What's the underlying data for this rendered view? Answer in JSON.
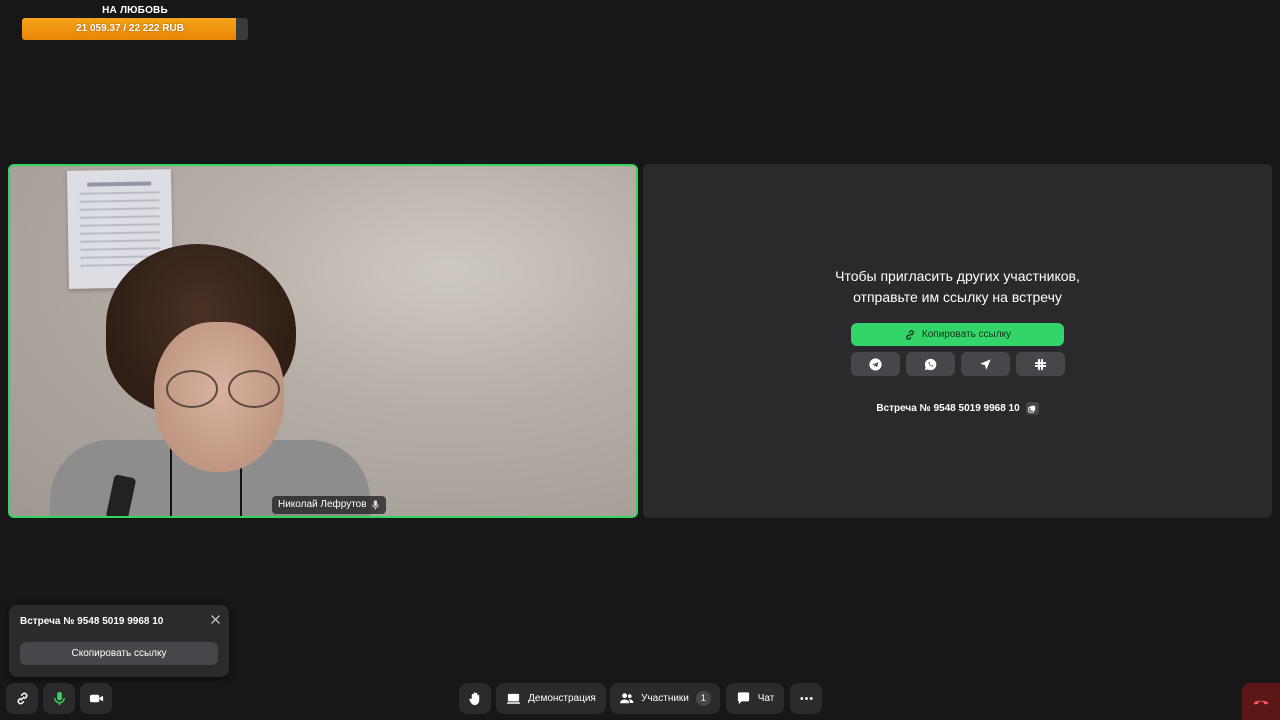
{
  "donation": {
    "title": "НА ЛЮБОВЬ",
    "amount_text": "21 059.37 / 22 222 RUB",
    "progress": 0.9477,
    "fill_color": "#f29a12"
  },
  "video": {
    "participant_name": "Николай Лефрутов",
    "active_speaker_color": "#35d55c",
    "mic_icon": "mic-icon"
  },
  "invite": {
    "title_line1": "Чтобы пригласить других участников,",
    "title_line2": "отправьте им ссылку на встречу",
    "copy_link_label": "Копировать ссылку",
    "share_targets": [
      "telegram-icon",
      "whatsapp-icon",
      "send-icon",
      "slack-icon"
    ],
    "meeting_label": "Встреча № 9548 5019 9968 10"
  },
  "popup": {
    "meeting_label": "Встреча № 9548 5019 9968 10",
    "copy_button_label": "Скопировать ссылку"
  },
  "toolbar": {
    "demo_label": "Демонстрация",
    "participants_label": "Участники",
    "participants_count": "1",
    "chat_label": "Чат",
    "mic_color": "#35d55c",
    "hangup_color": "#5b1716"
  }
}
